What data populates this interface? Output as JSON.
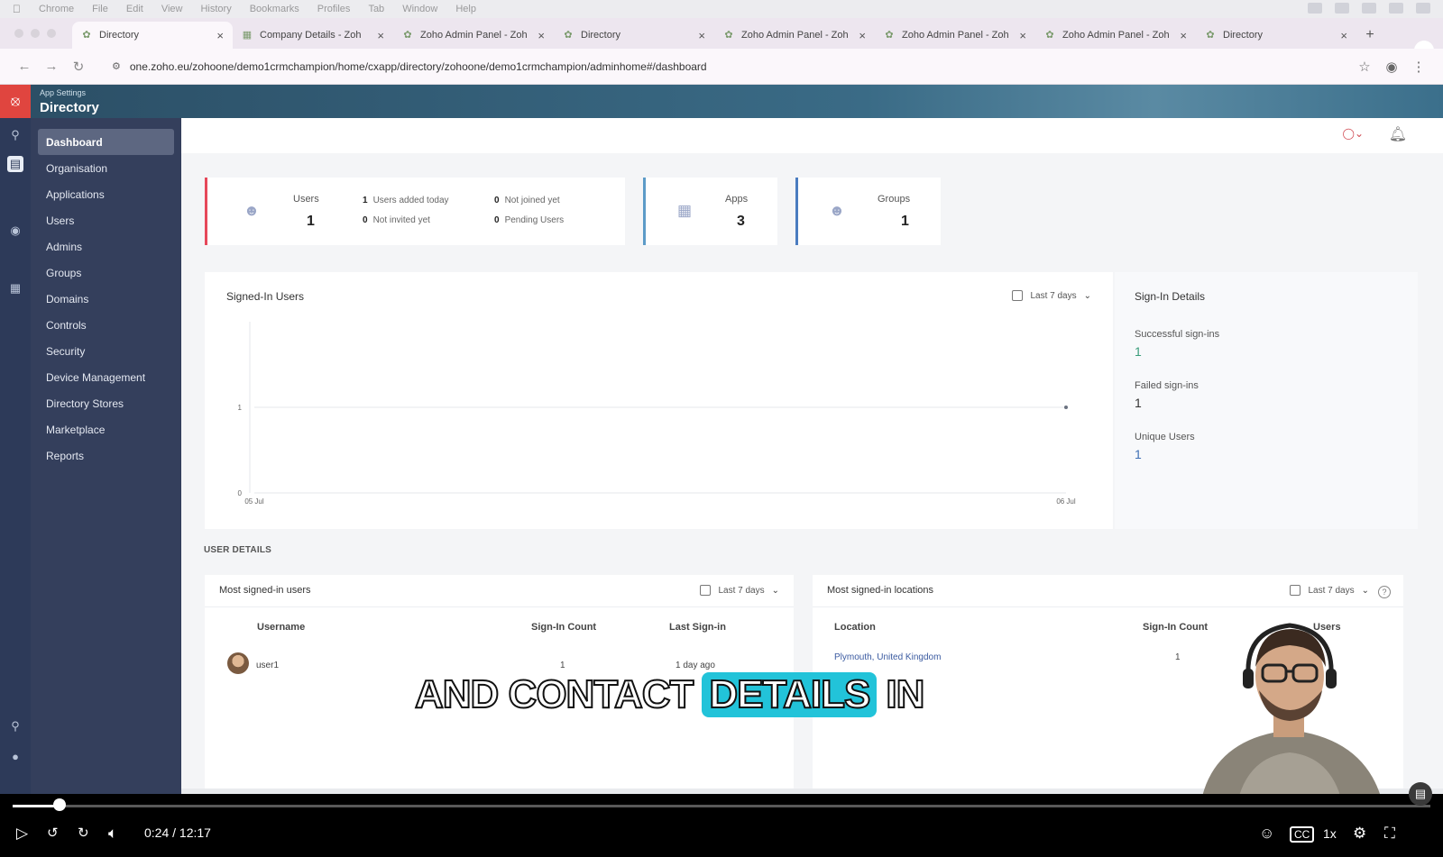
{
  "menubar": {
    "items": [
      "Chrome",
      "File",
      "Edit",
      "View",
      "History",
      "Bookmarks",
      "Profiles",
      "Tab",
      "Window",
      "Help"
    ]
  },
  "tabs": [
    {
      "label": "Directory",
      "active": true
    },
    {
      "label": "Company Details - Zoh"
    },
    {
      "label": "Zoho Admin Panel - Zoh"
    },
    {
      "label": "Directory"
    },
    {
      "label": "Zoho Admin Panel - Zoh"
    },
    {
      "label": "Zoho Admin Panel - Zoh"
    },
    {
      "label": "Zoho Admin Panel - Zoh"
    },
    {
      "label": "Directory"
    }
  ],
  "address": {
    "url": "one.zoho.eu/zohoone/demo1crmchampion/home/cxapp/directory/zohoone/demo1crmchampion/adminhome#/dashboard"
  },
  "app": {
    "section_label": "App Settings",
    "title": "Directory"
  },
  "sidebar": {
    "items": [
      "Dashboard",
      "Organisation",
      "Applications",
      "Users",
      "Admins",
      "Groups",
      "Domains",
      "Controls",
      "Security",
      "Device Management",
      "Directory Stores",
      "Marketplace",
      "Reports"
    ]
  },
  "kpi": {
    "users": {
      "label": "Users",
      "value": "1",
      "added_today_count": "1",
      "added_today_label": "Users added today",
      "not_invited_count": "0",
      "not_invited_label": "Not invited yet",
      "not_joined_count": "0",
      "not_joined_label": "Not joined yet",
      "pending_count": "0",
      "pending_label": "Pending Users"
    },
    "apps": {
      "label": "Apps",
      "value": "3"
    },
    "groups": {
      "label": "Groups",
      "value": "1"
    }
  },
  "signed_in": {
    "title": "Signed-In Users",
    "range": "Last 7 days"
  },
  "sign_in_details": {
    "title": "Sign-In Details",
    "successful_label": "Successful sign-ins",
    "successful_value": "1",
    "failed_label": "Failed sign-ins",
    "failed_value": "1",
    "unique_label": "Unique Users",
    "unique_value": "1"
  },
  "chart_data": {
    "type": "scatter",
    "title": "Signed-In Users",
    "x_tick_labels": [
      "05 Jul",
      "06 Jul"
    ],
    "y_ticks": [
      0,
      1
    ],
    "ylim": [
      0,
      2
    ],
    "points": [
      {
        "x": "06 Jul",
        "y": 1
      }
    ],
    "grid": true,
    "colors": {
      "point": "#6b7280",
      "grid": "#e5e7eb"
    }
  },
  "user_details": {
    "heading": "USER DETAILS",
    "left": {
      "title": "Most signed-in users",
      "range": "Last 7 days",
      "columns": [
        "Username",
        "Sign-In Count",
        "Last Sign-in"
      ],
      "row": {
        "username": "user1",
        "count": "1",
        "last": "1 day ago"
      }
    },
    "right": {
      "title": "Most signed-in locations",
      "range": "Last 7 days",
      "columns": [
        "Location",
        "Sign-In Count",
        "Users"
      ],
      "row": {
        "location": "Plymouth, United Kingdom",
        "count": "1"
      }
    }
  },
  "caption": {
    "before": "AND CONTACT",
    "highlight": "DETAILS",
    "after": "IN"
  },
  "video": {
    "time": "0:24 / 12:17",
    "progress": 0.033,
    "speed": "1x"
  },
  "colors": {
    "accent_red": "#e6485a",
    "sidebar": "#343f5c",
    "caption_highlight": "#22c3d9"
  }
}
